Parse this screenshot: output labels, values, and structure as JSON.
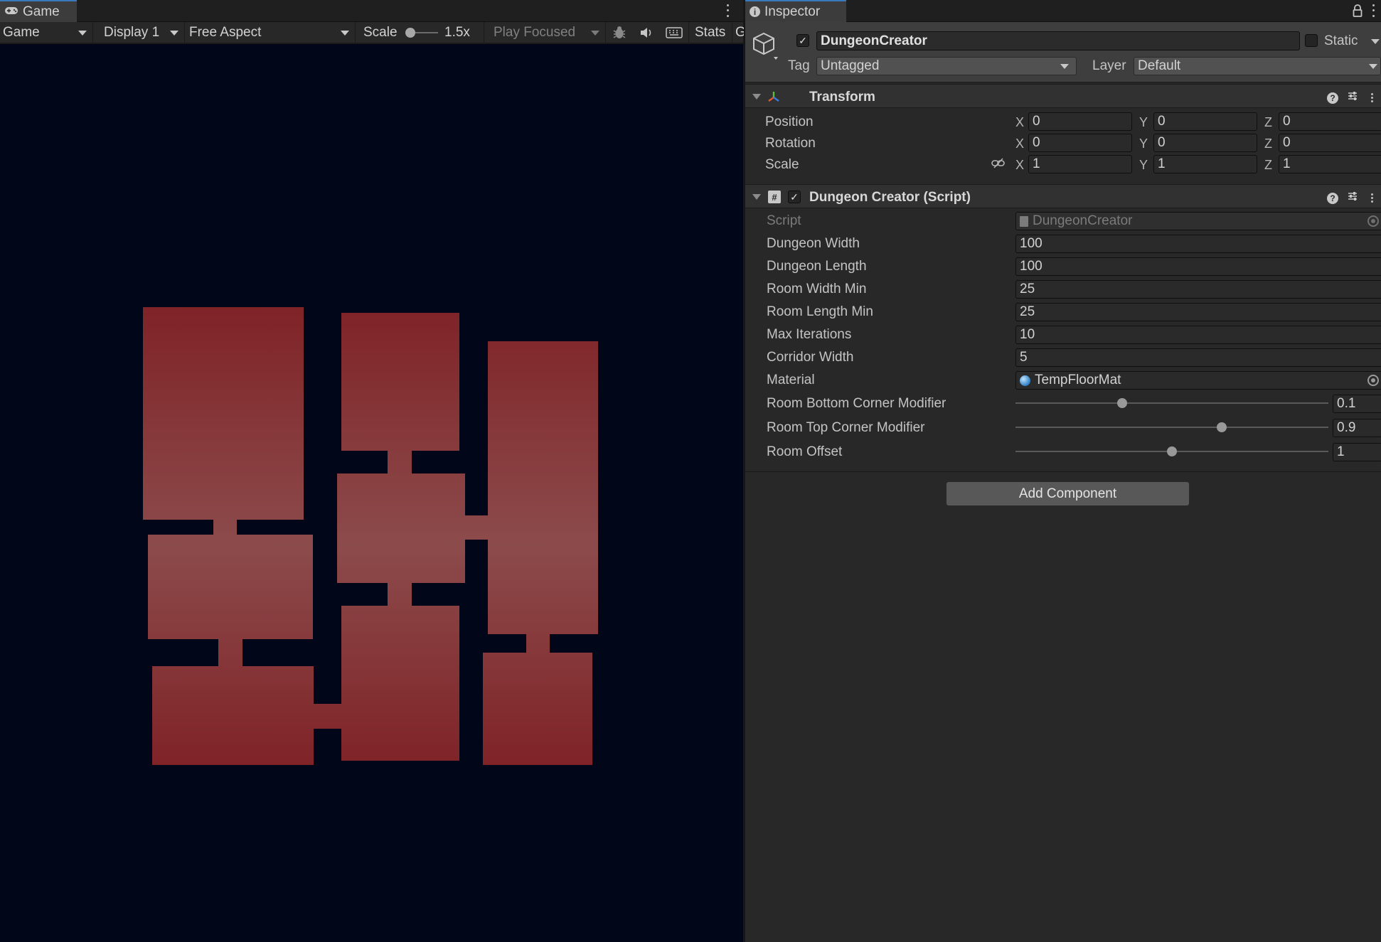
{
  "game": {
    "tab_label": "Game",
    "toolbar": {
      "mode": "Game",
      "display": "Display 1",
      "aspect": "Free Aspect",
      "scale_label": "Scale",
      "scale_value": "1.5x",
      "play_mode": "Play Focused",
      "stats": "Stats",
      "gizmos_cut": "G"
    },
    "viewport_background": "#020619",
    "room_color_top": "#7f2327",
    "room_color_mid": "#8c4b4b",
    "room_color_bottom": "#7f2327"
  },
  "inspector": {
    "tab_label": "Inspector",
    "object": {
      "name": "DungeonCreator",
      "active": true,
      "static_label": "Static",
      "tag_label": "Tag",
      "tag_value": "Untagged",
      "layer_label": "Layer",
      "layer_value": "Default"
    },
    "transform": {
      "title": "Transform",
      "rows": [
        {
          "label": "Position",
          "x": "0",
          "y": "0",
          "z": "0"
        },
        {
          "label": "Rotation",
          "x": "0",
          "y": "0",
          "z": "0"
        },
        {
          "label": "Scale",
          "x": "1",
          "y": "1",
          "z": "1"
        }
      ],
      "axis_x": "X",
      "axis_y": "Y",
      "axis_z": "Z"
    },
    "script_component": {
      "title": "Dungeon Creator (Script)",
      "enabled": true,
      "script_label": "Script",
      "script_value": "DungeonCreator",
      "fields": [
        {
          "label": "Dungeon Width",
          "value": "100"
        },
        {
          "label": "Dungeon Length",
          "value": "100"
        },
        {
          "label": "Room Width Min",
          "value": "25"
        },
        {
          "label": "Room Length Min",
          "value": "25"
        },
        {
          "label": "Max Iterations",
          "value": "10"
        },
        {
          "label": "Corridor Width",
          "value": "5"
        }
      ],
      "material_label": "Material",
      "material_value": "TempFloorMat",
      "sliders": [
        {
          "label": "Room Bottom Corner Modifier",
          "value": "0.1",
          "fraction": 0.34
        },
        {
          "label": "Room Top Corner Modifier",
          "value": "0.9",
          "fraction": 0.66
        },
        {
          "label": "Room Offset",
          "value": "1",
          "fraction": 0.5
        }
      ]
    },
    "add_component_label": "Add Component"
  }
}
